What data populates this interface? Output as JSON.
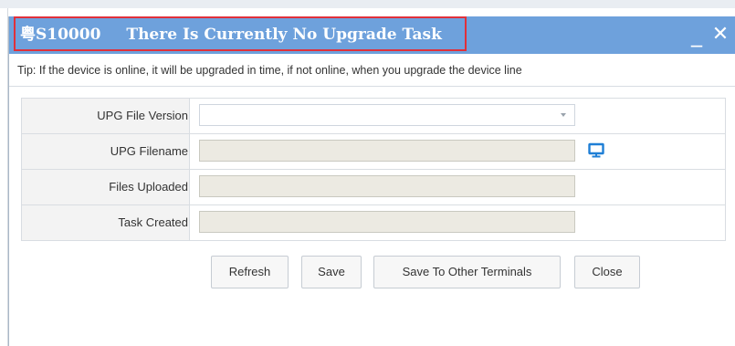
{
  "dialog": {
    "title_plate": "粤S10000",
    "title_status": "There Is Currently No Upgrade Task",
    "minimize_label": "_",
    "close_label": "✕",
    "tip": "Tip: If the device is online, it will be upgraded in time, if not online, when you upgrade the device line"
  },
  "form": {
    "rows": [
      {
        "label": "UPG File Version",
        "value": ""
      },
      {
        "label": "UPG Filename",
        "value": ""
      },
      {
        "label": "Files Uploaded",
        "value": ""
      },
      {
        "label": "Task Created",
        "value": ""
      }
    ],
    "browse_icon": "monitor-icon"
  },
  "buttons": {
    "refresh": "Refresh",
    "save": "Save",
    "save_other": "Save To Other Terminals",
    "close": "Close"
  },
  "colors": {
    "titlebar": "#6ea1dc",
    "highlight_border": "#e0303a",
    "icon_blue": "#1f7fd6"
  }
}
